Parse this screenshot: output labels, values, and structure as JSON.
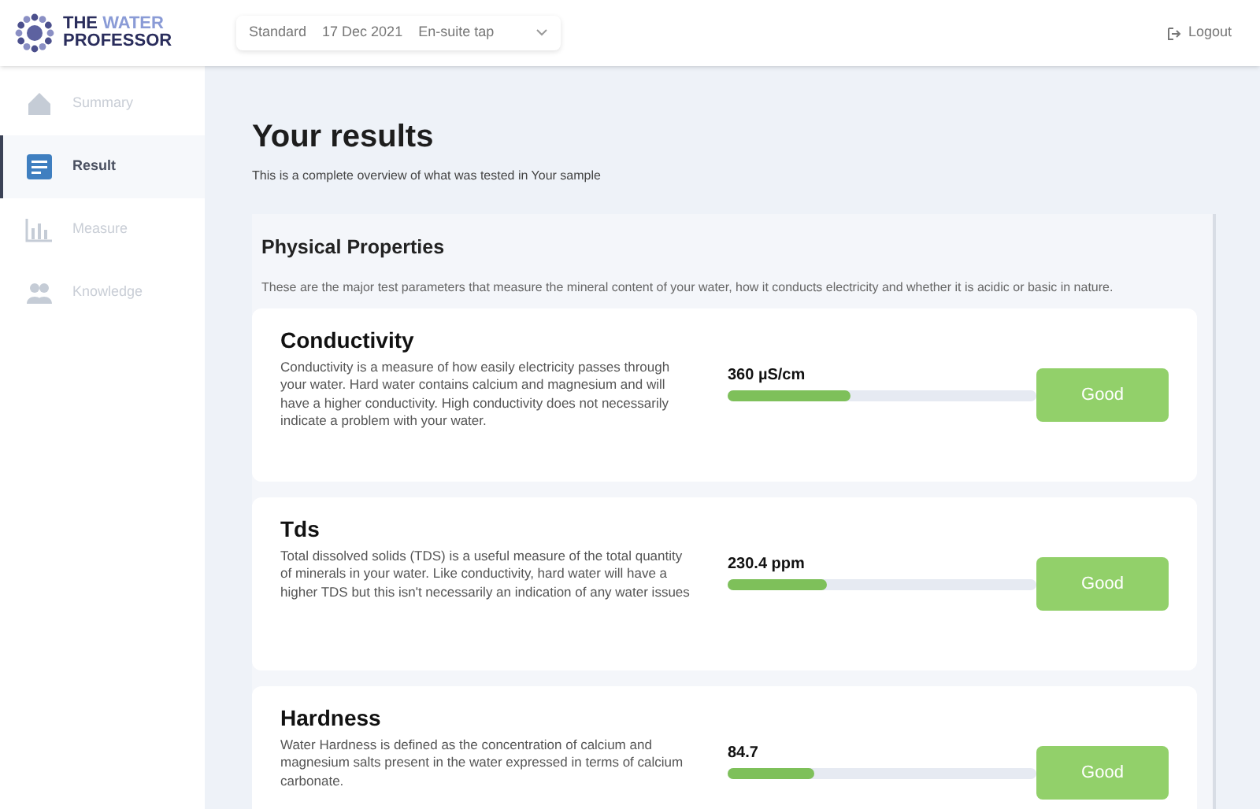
{
  "logo": {
    "line1": "THE",
    "line1_accent": "WATER",
    "line2": "PROFESSOR"
  },
  "sample_select": {
    "plan": "Standard",
    "date": "17 Dec 2021",
    "location": "En-suite tap"
  },
  "header": {
    "logout": "Logout"
  },
  "sidebar": {
    "items": [
      {
        "label": "Summary",
        "kind": "house",
        "selected": false
      },
      {
        "label": "Result",
        "kind": "document",
        "selected": true
      },
      {
        "label": "Measure",
        "kind": "chart",
        "selected": false
      },
      {
        "label": "Knowledge",
        "kind": "people",
        "selected": false
      }
    ]
  },
  "page": {
    "title": "Your results",
    "subtitle": "This is a complete overview of what was tested in Your sample"
  },
  "section": {
    "title": "Physical Properties",
    "description": "These are the major test parameters that measure the mineral content of your water, how it conducts electricity and whether it is acidic or basic in nature."
  },
  "results": [
    {
      "name": "Conductivity",
      "description": "Conductivity is a measure of how easily electricity passes through your water. Hard water contains calcium and magnesium and will have a higher conductivity. High conductivity does not necessarily indicate a problem with your water.",
      "reading": "360 µS/cm",
      "level": 0.4,
      "rating": "Good"
    },
    {
      "name": "Tds",
      "description": "Total dissolved solids (TDS) is a useful measure of the total quantity of minerals in your water. Like conductivity, hard water will have a higher TDS but this isn't necessarily an indication of any water issues",
      "reading": "230.4 ppm",
      "level": 0.32,
      "rating": "Good"
    },
    {
      "name": "Hardness",
      "description": "Water Hardness is defined as the concentration of calcium and magnesium salts present in the water expressed in terms of calcium carbonate.",
      "reading": "84.7",
      "level": 0.28,
      "rating": "Good"
    }
  ]
}
